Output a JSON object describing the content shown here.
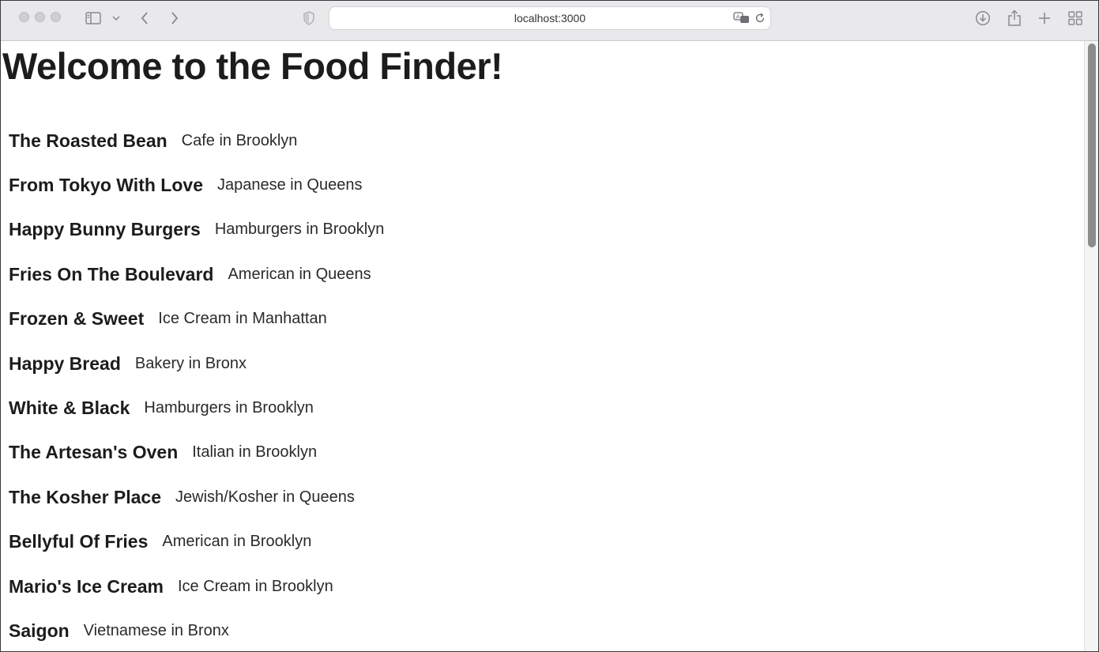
{
  "browser": {
    "url": "localhost:3000"
  },
  "page": {
    "title": "Welcome to the Food Finder!",
    "restaurants": [
      {
        "name": "The Roasted Bean",
        "description": "Cafe in Brooklyn"
      },
      {
        "name": "From Tokyo With Love",
        "description": "Japanese in Queens"
      },
      {
        "name": "Happy Bunny Burgers",
        "description": "Hamburgers in Brooklyn"
      },
      {
        "name": "Fries On The Boulevard",
        "description": "American in Queens"
      },
      {
        "name": "Frozen & Sweet",
        "description": "Ice Cream in Manhattan"
      },
      {
        "name": "Happy Bread",
        "description": "Bakery in Bronx"
      },
      {
        "name": "White & Black",
        "description": "Hamburgers in Brooklyn"
      },
      {
        "name": "The Artesan's Oven",
        "description": "Italian in Brooklyn"
      },
      {
        "name": "The Kosher Place",
        "description": "Jewish/Kosher in Queens"
      },
      {
        "name": "Bellyful Of Fries",
        "description": "American in Brooklyn"
      },
      {
        "name": "Mario's Ice Cream",
        "description": "Ice Cream in Brooklyn"
      },
      {
        "name": "Saigon",
        "description": "Vietnamese in Bronx"
      }
    ]
  },
  "icons": [
    "sidebar-icon",
    "chevron-down-icon",
    "back-icon",
    "forward-icon",
    "shield-icon",
    "translate-icon",
    "reload-icon",
    "download-icon",
    "share-icon",
    "new-tab-icon",
    "tab-overview-icon"
  ]
}
